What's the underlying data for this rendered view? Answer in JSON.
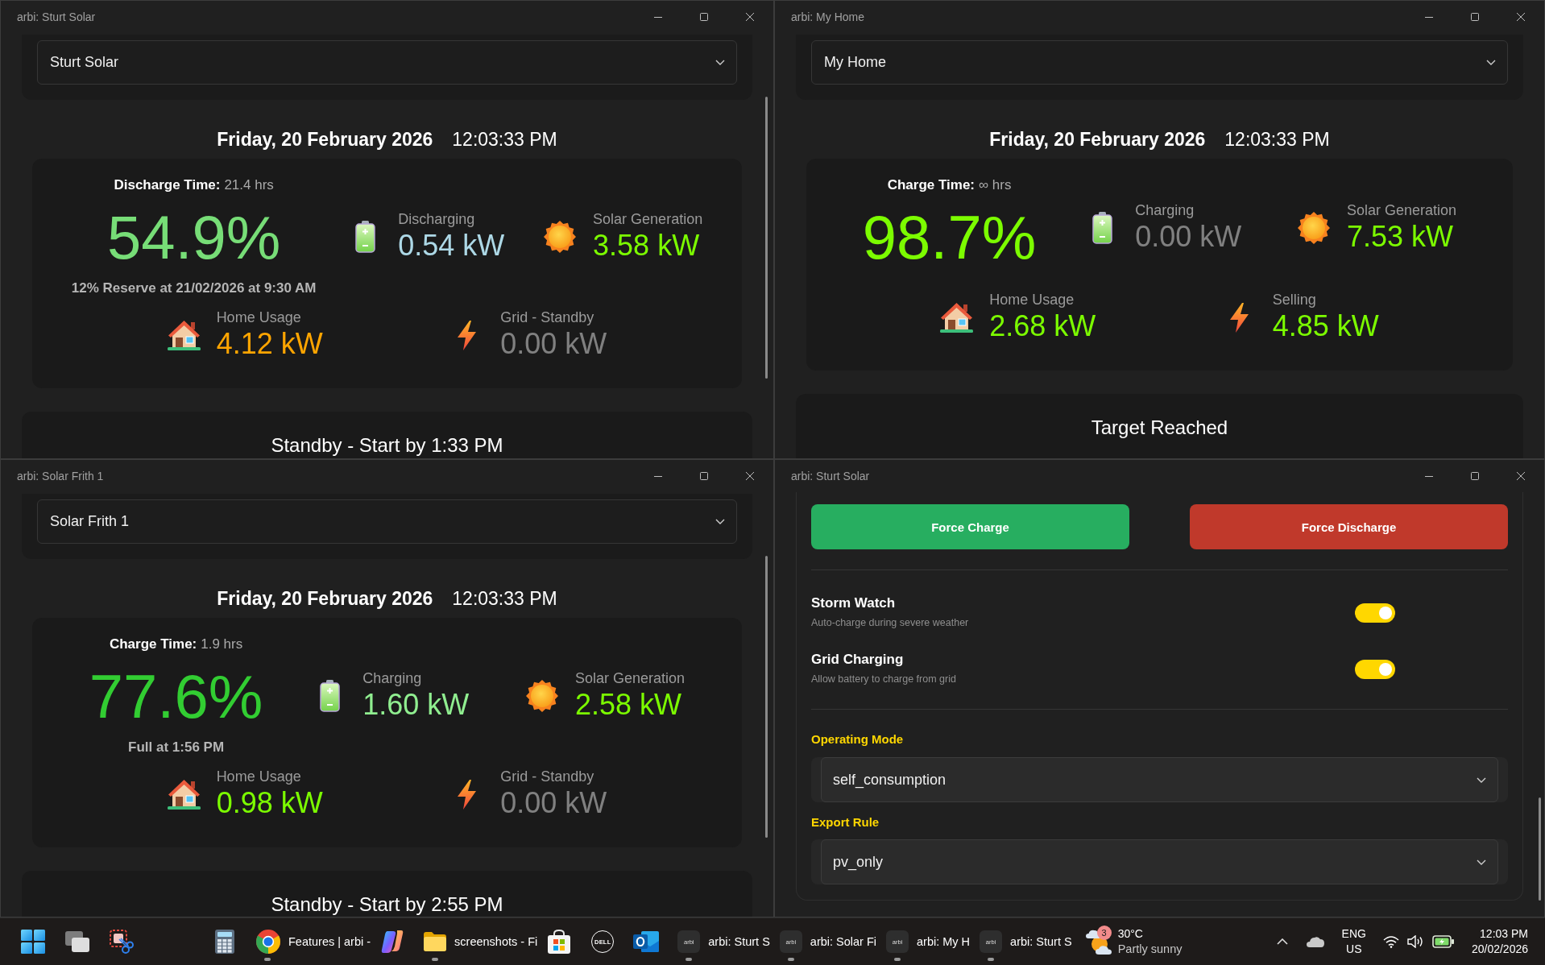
{
  "windows": [
    {
      "kind": "dashboard",
      "title": "arbi: Sturt Solar",
      "scrollbar": true,
      "site": "Sturt Solar",
      "date": "Friday, 20 February 2026",
      "time": "12:03:33 PM",
      "battery": {
        "time_label": "Discharge Time:",
        "time_value": "21.4 hrs",
        "percent": "54.9%",
        "color": "#77dd77",
        "note": "12% Reserve at 21/02/2026 at 9:30 AM"
      },
      "metrics": [
        {
          "kind": "battery",
          "label": "Discharging",
          "value": "0.54 kW",
          "color": "#add8e6"
        },
        {
          "kind": "solar",
          "label": "Solar Generation",
          "value": "3.58 kW",
          "color": "#7cfc00"
        },
        {
          "kind": "home",
          "label": "Home Usage",
          "value": "4.12 kW",
          "color": "#ffa500"
        },
        {
          "kind": "grid",
          "label": "Grid - Standby",
          "value": "0.00 kW",
          "color": "#808080"
        }
      ],
      "status": "Standby - Start by 1:33 PM"
    },
    {
      "kind": "dashboard",
      "title": "arbi: My Home",
      "scrollbar": false,
      "site": "My Home",
      "date": "Friday, 20 February 2026",
      "time": "12:03:33 PM",
      "battery": {
        "time_label": "Charge Time:",
        "time_value": "∞ hrs",
        "percent": "98.7%",
        "color": "#7cfc00"
      },
      "metrics": [
        {
          "kind": "battery",
          "label": "Charging",
          "value": "0.00 kW",
          "color": "#808080"
        },
        {
          "kind": "solar",
          "label": "Solar Generation",
          "value": "7.53 kW",
          "color": "#7cfc00"
        },
        {
          "kind": "home",
          "label": "Home Usage",
          "value": "2.68 kW",
          "color": "#7cfc00"
        },
        {
          "kind": "grid",
          "label": "Selling",
          "value": "4.85 kW",
          "color": "#7cfc00"
        }
      ],
      "status": "Target Reached"
    },
    {
      "kind": "dashboard",
      "title": "arbi: Solar Frith 1",
      "scrollbar": true,
      "site": "Solar Frith 1",
      "date": "Friday, 20 February 2026",
      "time": "12:03:33 PM",
      "battery": {
        "time_label": "Charge Time:",
        "time_value": "1.9 hrs",
        "percent": "77.6%",
        "color": "#32cd32",
        "note": "Full at 1:56 PM"
      },
      "metrics": [
        {
          "kind": "battery",
          "label": "Charging",
          "value": "1.60 kW",
          "color": "#90ee90"
        },
        {
          "kind": "solar",
          "label": "Solar Generation",
          "value": "2.58 kW",
          "color": "#7cfc00"
        },
        {
          "kind": "home",
          "label": "Home Usage",
          "value": "0.98 kW",
          "color": "#7cfc00"
        },
        {
          "kind": "grid",
          "label": "Grid - Standby",
          "value": "0.00 kW",
          "color": "#808080"
        }
      ],
      "status": "Standby - Start by 2:55 PM"
    },
    {
      "kind": "controls",
      "title": "arbi: Sturt Solar",
      "scrollbar": true,
      "buttons": [
        {
          "kind": "charge",
          "label": "Force Charge"
        },
        {
          "kind": "discharge",
          "label": "Force Discharge"
        }
      ],
      "toggles": [
        {
          "label": "Storm Watch",
          "description": "Auto-charge during severe weather",
          "on": true
        },
        {
          "label": "Grid Charging",
          "description": "Allow battery to charge from grid",
          "on": true
        }
      ],
      "selects": [
        {
          "label": "Operating Mode",
          "value": "self_consumption"
        },
        {
          "label": "Export Rule",
          "value": "pv_only"
        }
      ]
    }
  ],
  "taskbar": {
    "left_items": [
      {
        "kind": "start",
        "running": false
      },
      {
        "kind": "task_view",
        "running": false
      },
      {
        "kind": "snipping",
        "running": false
      }
    ],
    "items": [
      {
        "kind": "calculator",
        "running": false
      },
      {
        "kind": "browser",
        "label": "Features | arbi -",
        "running": true
      },
      {
        "kind": "copilot",
        "running": false
      },
      {
        "kind": "folder",
        "label": "screenshots - Fi",
        "running": true
      },
      {
        "kind": "store",
        "running": false
      },
      {
        "kind": "dell",
        "logo_text": "DELL",
        "running": false
      },
      {
        "kind": "mail",
        "running": false
      },
      {
        "kind": "arbi",
        "logo_text": "arbi",
        "label": "arbi: Sturt S",
        "running": true
      },
      {
        "kind": "arbi",
        "logo_text": "arbi",
        "label": "arbi: Solar Fi",
        "running": true
      },
      {
        "kind": "arbi",
        "logo_text": "arbi",
        "label": "arbi: My H",
        "running": true
      },
      {
        "kind": "arbi",
        "logo_text": "arbi",
        "label": "arbi: Sturt S",
        "running": true
      }
    ],
    "weather": {
      "badge": "3",
      "temperature": "30°C",
      "condition": "Partly sunny"
    },
    "language": "ENG",
    "region": "US",
    "time": "12:03 PM",
    "date": "20/02/2026"
  }
}
